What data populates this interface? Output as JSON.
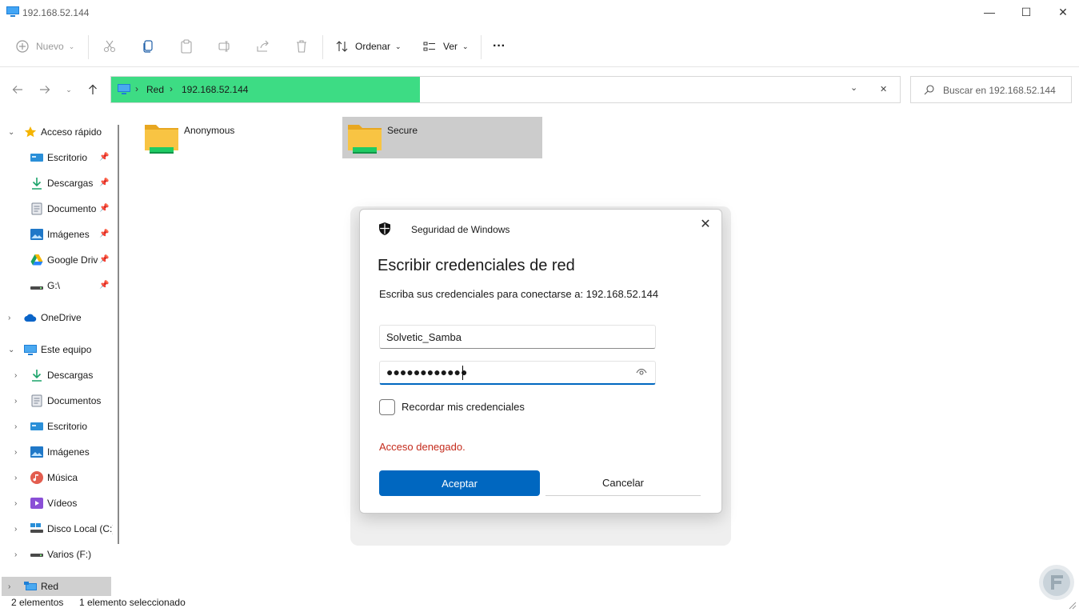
{
  "window": {
    "title": "192.168.52.144",
    "minimize_glyph": "—",
    "maximize_glyph": "☐",
    "close_glyph": "✕"
  },
  "toolbar": {
    "new_label": "Nuevo",
    "sort_label": "Ordenar",
    "view_label": "Ver",
    "more_label": "···",
    "icons": [
      "cut-icon",
      "copy-icon",
      "paste-icon",
      "rename-icon",
      "share-icon",
      "delete-icon"
    ]
  },
  "address": {
    "crumbs": [
      "Red",
      "192.168.52.144"
    ],
    "separator": "›",
    "search_placeholder": "Buscar en 192.168.52.144"
  },
  "sidebar": {
    "quick_access": {
      "label": "Acceso rápido",
      "items": [
        {
          "label": "Escritorio",
          "icon": "desktop-icon",
          "pinned": true
        },
        {
          "label": "Descargas",
          "icon": "download-icon",
          "pinned": true
        },
        {
          "label": "Documento",
          "icon": "documents-icon",
          "pinned": true
        },
        {
          "label": "Imágenes",
          "icon": "pictures-icon",
          "pinned": true
        },
        {
          "label": "Google Drive",
          "icon": "google-drive-icon",
          "pinned": true
        },
        {
          "label": "G:\\",
          "icon": "drive-icon",
          "pinned": true
        }
      ]
    },
    "onedrive_label": "OneDrive",
    "this_pc": {
      "label": "Este equipo",
      "items": [
        {
          "label": "Descargas",
          "icon": "download-icon"
        },
        {
          "label": "Documentos",
          "icon": "documents-icon"
        },
        {
          "label": "Escritorio",
          "icon": "desktop-icon"
        },
        {
          "label": "Imágenes",
          "icon": "pictures-icon"
        },
        {
          "label": "Música",
          "icon": "music-icon"
        },
        {
          "label": "Vídeos",
          "icon": "videos-icon"
        },
        {
          "label": "Disco Local (C:)",
          "icon": "local-disk-icon"
        },
        {
          "label": "Varios (F:)",
          "icon": "drive-icon"
        }
      ]
    },
    "network_label": "Red"
  },
  "content": {
    "folders": [
      {
        "name": "Anonymous",
        "selected": false
      },
      {
        "name": "Secure",
        "selected": true
      }
    ]
  },
  "status": {
    "count": "2 elementos",
    "selection": "1 elemento seleccionado"
  },
  "dialog": {
    "app_title": "Seguridad de Windows",
    "heading": "Escribir credenciales de red",
    "prompt": "Escriba sus credenciales para conectarse a: 192.168.52.144",
    "username_value": "Solvetic_Samba",
    "password_dots": "●●●●●●●●●●●●",
    "remember_label": "Recordar mis credenciales",
    "remember_checked": false,
    "error_text": "Acceso denegado.",
    "ok_label": "Aceptar",
    "cancel_label": "Cancelar",
    "close_glyph": "✕"
  },
  "colors": {
    "accent": "#0067c0",
    "error": "#c42b1c",
    "address_highlight": "#3ddc84",
    "folder_yellow": "#f8c443",
    "selection_gray": "#cccccc"
  }
}
